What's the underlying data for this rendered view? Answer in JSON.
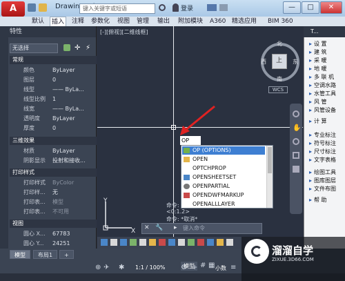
{
  "app": {
    "logo_letter": "A",
    "doc_title": "Drawing1.d...",
    "search_placeholder": "键入关键字或短语",
    "user": "登录"
  },
  "ribbon": {
    "tabs": [
      "默认",
      "插入",
      "注释",
      "参数化",
      "视图",
      "管理",
      "输出",
      "附加模块",
      "A360",
      "精选应用",
      "BIM 360"
    ],
    "active_index": 1
  },
  "props": {
    "title": "特性",
    "selection": "无选择",
    "sections": [
      {
        "head": "常规",
        "rows": [
          {
            "k": "颜色",
            "v": "ByLayer"
          },
          {
            "k": "图层",
            "v": "0"
          },
          {
            "k": "线型",
            "v": "—— ByLa..."
          },
          {
            "k": "线型比例",
            "v": "1"
          },
          {
            "k": "线宽",
            "v": "—— ByLa..."
          },
          {
            "k": "透明度",
            "v": "ByLayer"
          },
          {
            "k": "厚度",
            "v": "0"
          }
        ]
      },
      {
        "head": "三维效果",
        "rows": [
          {
            "k": "材质",
            "v": "ByLayer"
          },
          {
            "k": "阴影显示",
            "v": "投射和接收..."
          }
        ]
      },
      {
        "head": "打印样式",
        "rows": [
          {
            "k": "打印样式",
            "v": "ByColor"
          },
          {
            "k": "打印样...",
            "v": "无"
          },
          {
            "k": "打印表...",
            "v": "模型"
          },
          {
            "k": "打印表...",
            "v": "不可用"
          }
        ]
      },
      {
        "head": "视图",
        "rows": [
          {
            "k": "圆心 X...",
            "v": "67783"
          },
          {
            "k": "圆心 Y...",
            "v": "24251"
          }
        ]
      }
    ]
  },
  "canvas": {
    "view_label": "[-][俯视][二维线框]",
    "compass": {
      "n": "北",
      "s": "南",
      "w": "西",
      "e": "东",
      "top": "上"
    },
    "wcs": "WCS",
    "ucs_y": "Y",
    "ucs_x": "X"
  },
  "command": {
    "typed": "OP",
    "items": [
      {
        "label": "OP (OPTIONS)",
        "icon": "options-icon",
        "selected": true
      },
      {
        "label": "OPEN",
        "icon": "open-folder-icon",
        "selected": false
      },
      {
        "label": "OPTCHPROP",
        "icon": "",
        "selected": false
      },
      {
        "label": "OPENSHEETSET",
        "icon": "sheetset-icon",
        "selected": false
      },
      {
        "label": "OPENPARTIAL",
        "icon": "partial-open-icon",
        "selected": false
      },
      {
        "label": "OPENDWFMARKUP",
        "icon": "dwf-markup-icon",
        "selected": false
      },
      {
        "label": "OPENALLLAYER",
        "icon": "",
        "selected": false
      }
    ],
    "history": [
      "命令:",
      "<0:1.2>",
      "命令: *取消*"
    ],
    "prompt": "键入命令"
  },
  "layout_tabs": [
    "模型",
    "布局1",
    "+"
  ],
  "status": {
    "model": "模型",
    "scale": "1:1 / 100%",
    "decimal": "小数"
  },
  "palette": {
    "title": "T...",
    "items": [
      "设 置",
      "建 筑",
      "采 暖",
      "地 暖",
      "多 联 机",
      "空调水路",
      "水管工具",
      "风 管",
      "风管设备",
      "计 算",
      "专业标注",
      "符号标注",
      "尺寸标注",
      "文字表格",
      "绘图工具",
      "图库图层",
      "文件布图",
      "帮 助"
    ]
  },
  "watermark": {
    "title": "溜溜自学",
    "url": "ZIXUE.3D66.COM"
  }
}
